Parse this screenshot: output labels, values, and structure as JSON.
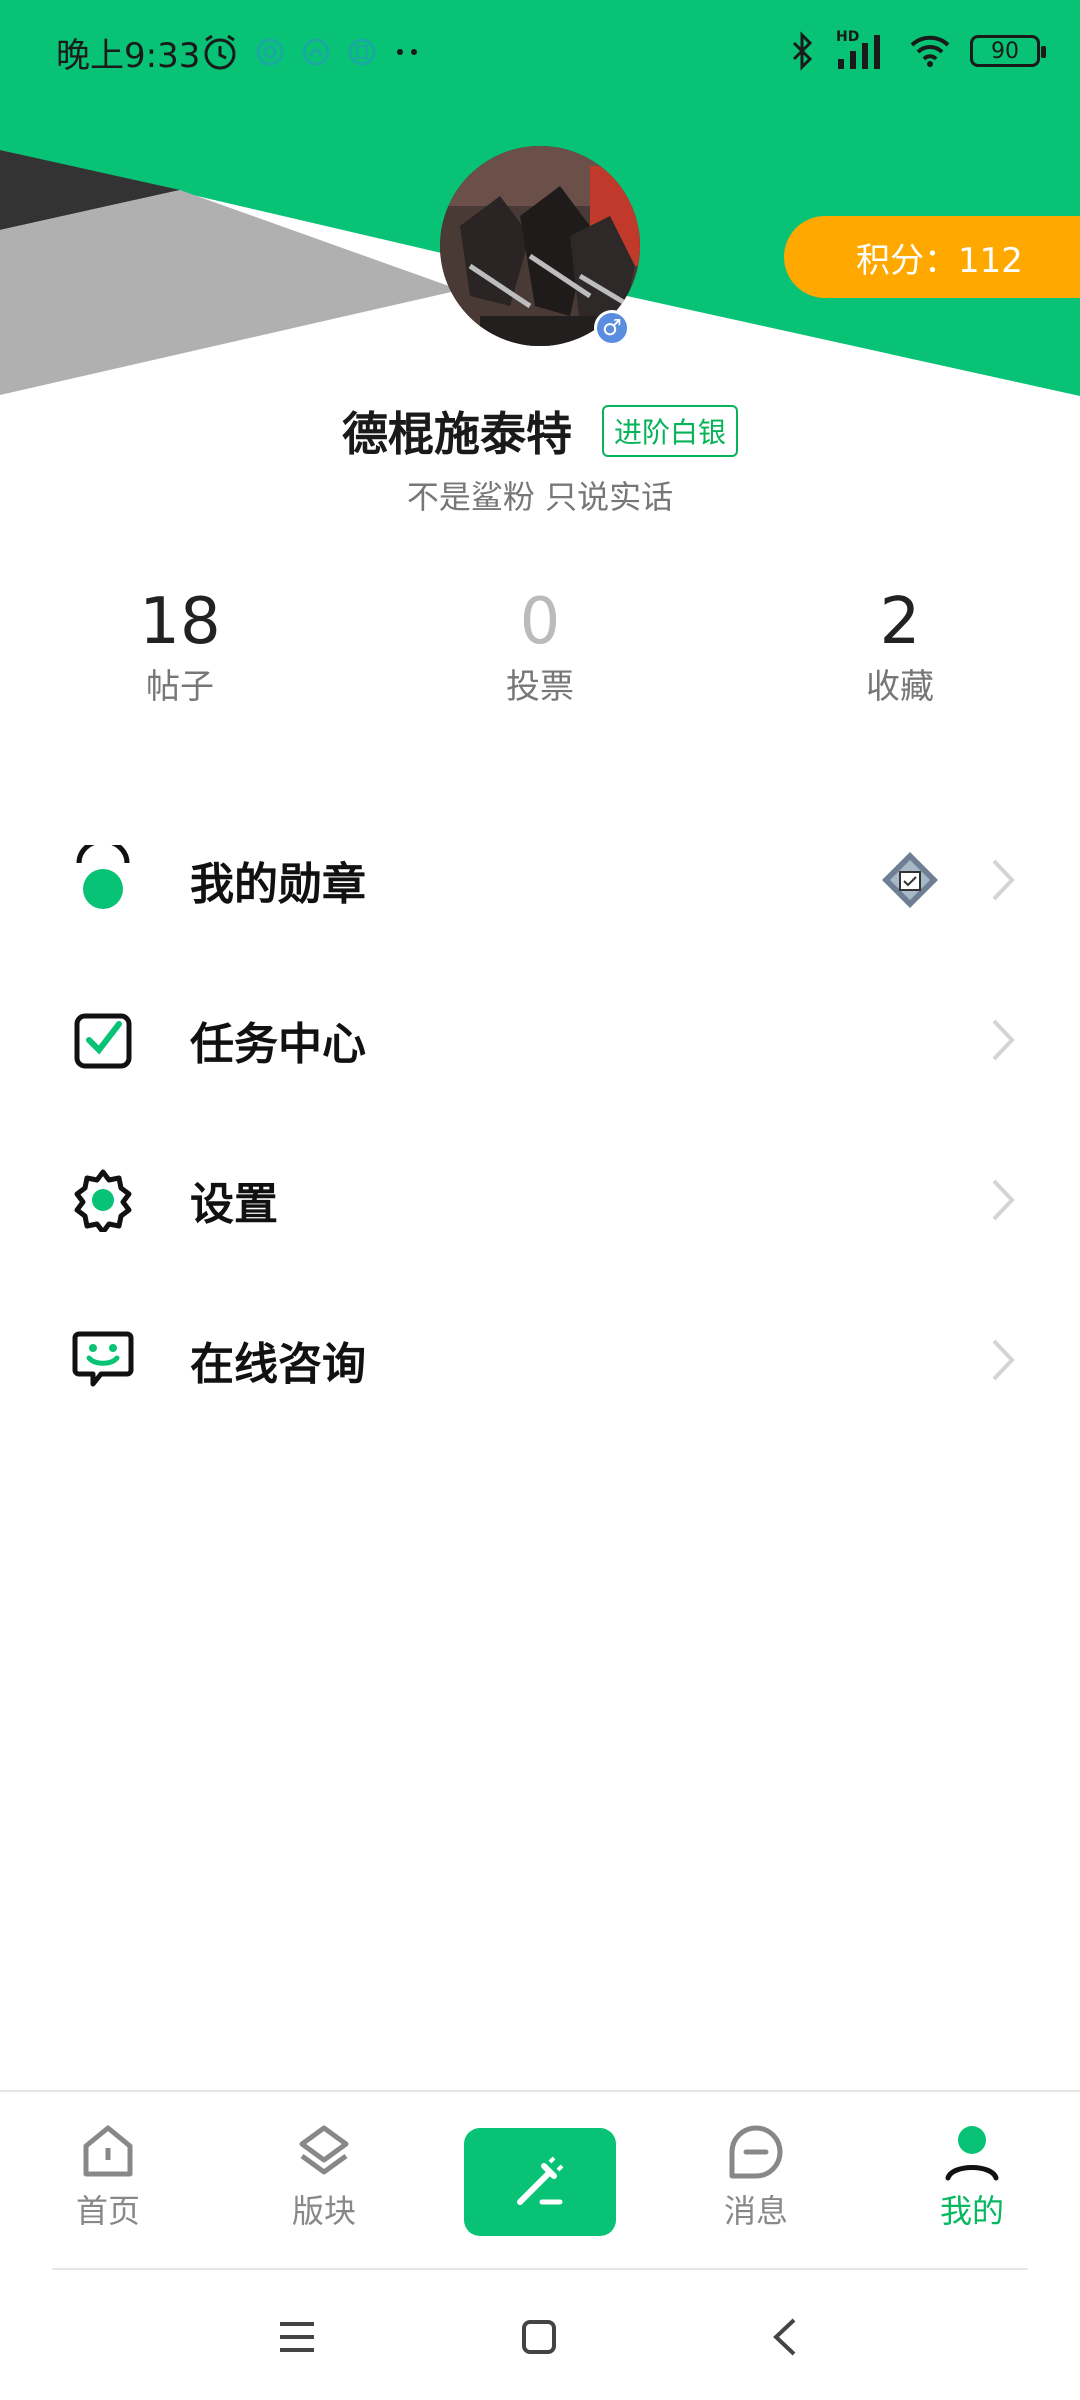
{
  "status_bar": {
    "time": "晚上9:33",
    "battery": "90",
    "network_label": "HD"
  },
  "profile": {
    "points_label": "积分：112",
    "username": "德棍施泰特",
    "rank": "进阶白银",
    "bio": "不是鲨粉 只说实话",
    "gender_symbol": "♂"
  },
  "stats": [
    {
      "value": "18",
      "label": "帖子"
    },
    {
      "value": "0",
      "label": "投票"
    },
    {
      "value": "2",
      "label": "收藏"
    }
  ],
  "menu": {
    "medals": "我的勋章",
    "tasks": "任务中心",
    "settings": "设置",
    "consult": "在线咨询"
  },
  "tabbar": {
    "home": "首页",
    "boards": "版块",
    "messages": "消息",
    "mine": "我的"
  },
  "colors": {
    "brand_green": "#08c276",
    "accent_orange": "#ffa800",
    "rank_green": "#08b35a"
  }
}
